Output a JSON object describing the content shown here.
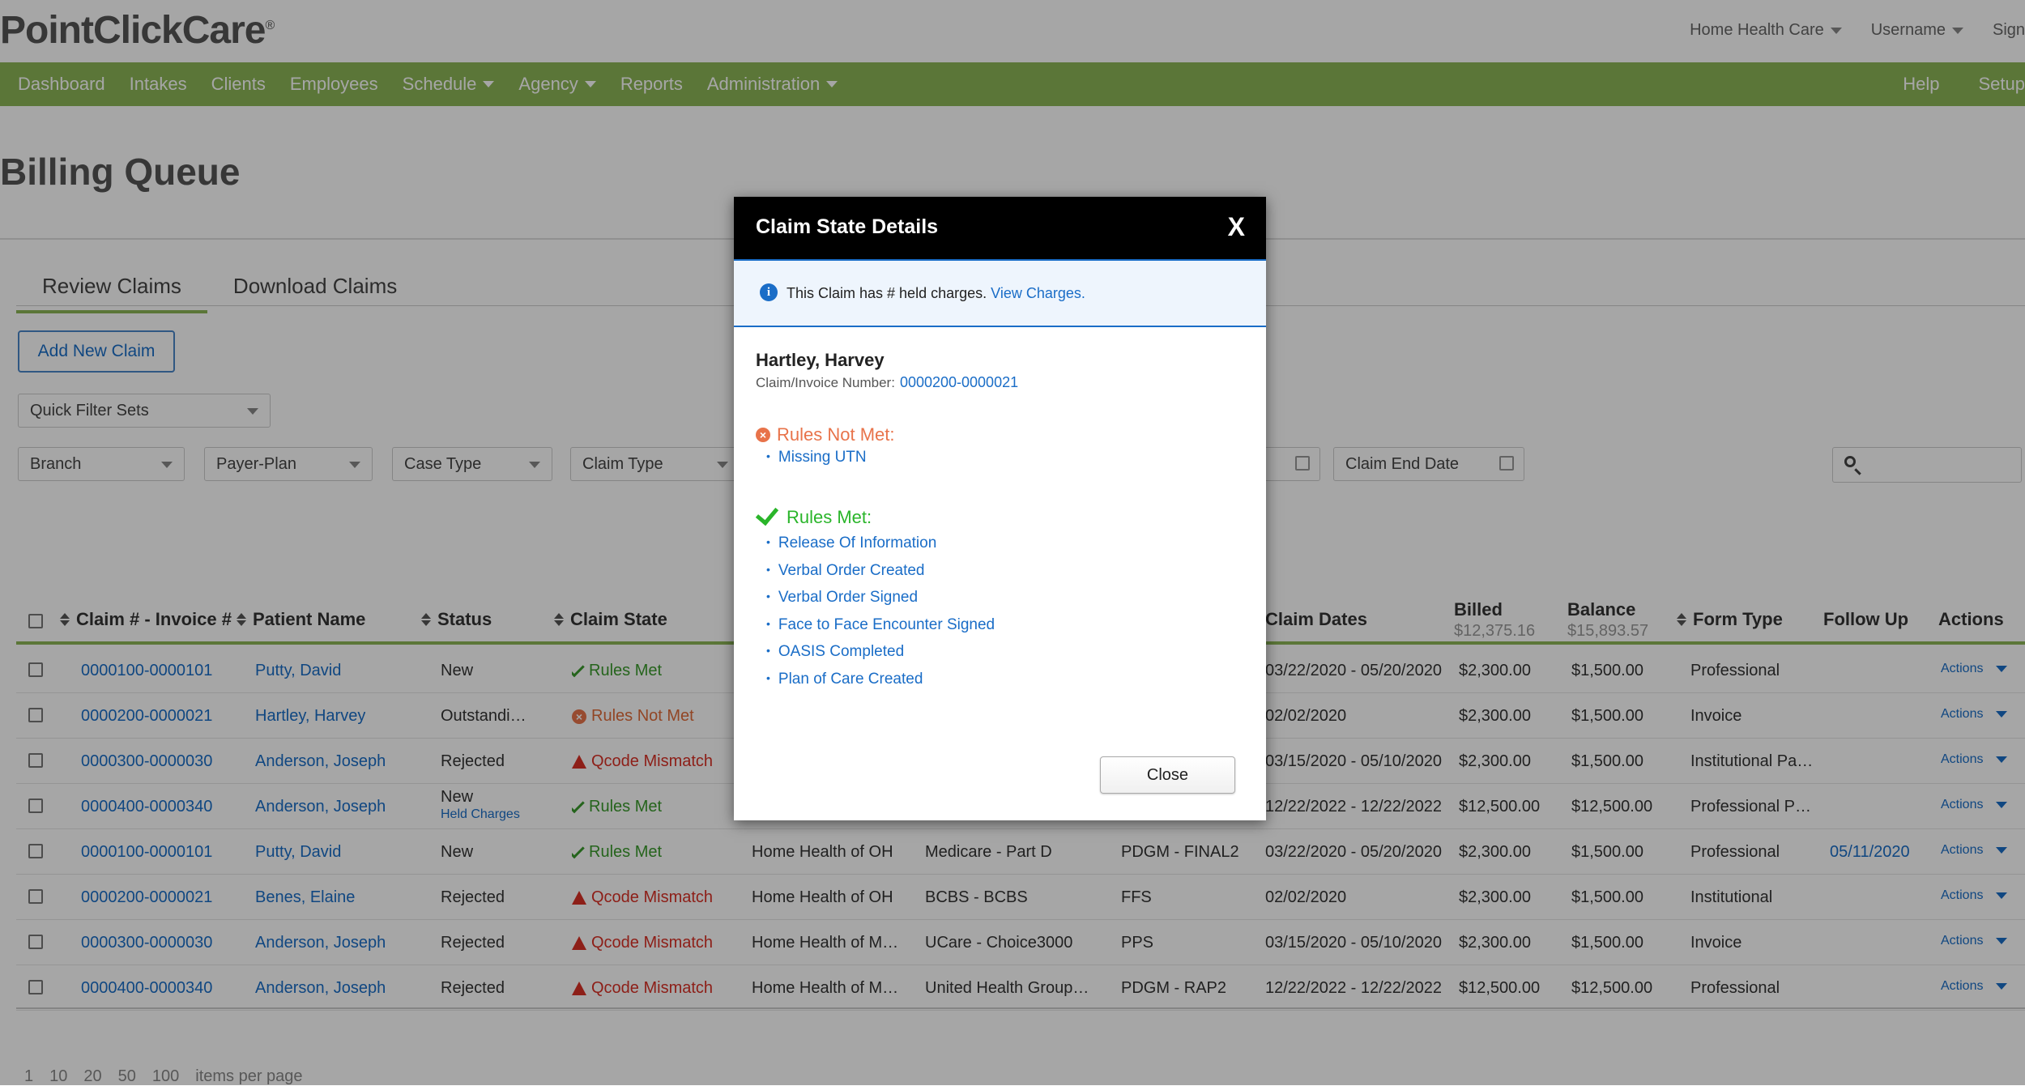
{
  "header": {
    "logo": "PointClickCare",
    "logo_mark": "®",
    "agency": "Home Health Care",
    "user": "Username",
    "signout": "Sign Out"
  },
  "nav": {
    "items": [
      "Dashboard",
      "Intakes",
      "Clients",
      "Employees",
      "Schedule",
      "Agency",
      "Reports",
      "Administration"
    ],
    "right": [
      "Help",
      "Setup"
    ]
  },
  "page": {
    "title": "Billing Queue",
    "tabs": [
      "Review Claims",
      "Download Claims"
    ],
    "add_button": "Add New Claim",
    "filters": {
      "quick": "Quick Filter Sets",
      "branch": "Branch",
      "payer": "Payer-Plan",
      "case": "Case Type",
      "claim_type": "Claim Type",
      "claim_end": "Claim End Date"
    }
  },
  "table": {
    "headers": {
      "claim": "Claim # - Invoice #",
      "patient": "Patient Name",
      "status": "Status",
      "state": "Claim State",
      "dates": "Claim Dates",
      "billed": "Billed",
      "billed_total": "$12,375.16",
      "balance": "Balance",
      "balance_total": "$15,893.57",
      "form": "Form Type",
      "follow": "Follow Up",
      "actions": "Actions"
    },
    "rows": [
      {
        "claim": "0000100-0000101",
        "patient": "Putty, David",
        "status": "New",
        "status_sub": "",
        "state": "Rules Met",
        "state_kind": "ok",
        "branch": "",
        "payer": "",
        "type": "",
        "dates": "03/22/2020 - 05/20/2020",
        "billed": "$2,300.00",
        "balance": "$1,500.00",
        "form": "Professional",
        "follow": "",
        "actions": "Actions"
      },
      {
        "claim": "0000200-0000021",
        "patient": "Hartley, Harvey",
        "status": "Outstandi…",
        "status_sub": "",
        "state": "Rules Not Met",
        "state_kind": "notmet",
        "branch": "",
        "payer": "",
        "type": "",
        "dates": "02/02/2020",
        "billed": "$2,300.00",
        "balance": "$1,500.00",
        "form": "Invoice",
        "follow": "",
        "actions": "Actions"
      },
      {
        "claim": "0000300-0000030",
        "patient": "Anderson, Joseph",
        "status": "Rejected",
        "status_sub": "",
        "state": "Qcode Mismatch",
        "state_kind": "bad",
        "branch": "",
        "payer": "",
        "type": "",
        "dates": "03/15/2020 - 05/10/2020",
        "billed": "$2,300.00",
        "balance": "$1,500.00",
        "form": "Institutional Pa…",
        "follow": "",
        "actions": "Actions"
      },
      {
        "claim": "0000400-0000340",
        "patient": "Anderson, Joseph",
        "status": "New",
        "status_sub": "Held Charges",
        "state": "Rules Met",
        "state_kind": "ok",
        "branch": "",
        "payer": "",
        "type": "",
        "dates": "12/22/2022 - 12/22/2022",
        "billed": "$12,500.00",
        "balance": "$12,500.00",
        "form": "Professional P…",
        "follow": "",
        "actions": "Actions"
      },
      {
        "claim": "0000100-0000101",
        "patient": "Putty, David",
        "status": "New",
        "status_sub": "",
        "state": "Rules Met",
        "state_kind": "ok",
        "branch": "Home Health of OH",
        "payer": "Medicare - Part D",
        "type": "PDGM - FINAL2",
        "dates": "03/22/2020 - 05/20/2020",
        "billed": "$2,300.00",
        "balance": "$1,500.00",
        "form": "Professional",
        "follow": "05/11/2020",
        "actions": "Actions"
      },
      {
        "claim": "0000200-0000021",
        "patient": "Benes, Elaine",
        "status": "Rejected",
        "status_sub": "",
        "state": "Qcode Mismatch",
        "state_kind": "bad",
        "branch": "Home Health of OH",
        "payer": "BCBS - BCBS",
        "type": "FFS",
        "dates": "02/02/2020",
        "billed": "$2,300.00",
        "balance": "$1,500.00",
        "form": "Institutional",
        "follow": "",
        "actions": "Actions"
      },
      {
        "claim": "0000300-0000030",
        "patient": "Anderson, Joseph",
        "status": "Rejected",
        "status_sub": "",
        "state": "Qcode Mismatch",
        "state_kind": "bad",
        "branch": "Home Health of M…",
        "payer": "UCare - Choice3000",
        "type": "PPS",
        "dates": "03/15/2020 - 05/10/2020",
        "billed": "$2,300.00",
        "balance": "$1,500.00",
        "form": "Invoice",
        "follow": "",
        "actions": "Actions"
      },
      {
        "claim": "0000400-0000340",
        "patient": "Anderson, Joseph",
        "status": "Rejected",
        "status_sub": "",
        "state": "Qcode Mismatch",
        "state_kind": "bad",
        "branch": "Home Health of M…",
        "payer": "United Health Group…",
        "type": "PDGM - RAP2",
        "dates": "12/22/2022 - 12/22/2022",
        "billed": "$12,500.00",
        "balance": "$12,500.00",
        "form": "Professional",
        "follow": "",
        "actions": "Actions"
      }
    ]
  },
  "pager": {
    "pages": "1",
    "of": "10",
    "sizes": [
      "20",
      "50",
      "100"
    ],
    "label": "items per page"
  },
  "modal": {
    "title": "Claim State Details",
    "close_x": "X",
    "info_text": "This Claim has # held charges.",
    "info_link": "View Charges.",
    "patient": "Hartley, Harvey",
    "claim_label": "Claim/Invoice Number:",
    "claim_number": "0000200-0000021",
    "not_met_title": "Rules Not Met:",
    "not_met": [
      "Missing UTN"
    ],
    "met_title": "Rules Met:",
    "met": [
      "Release Of Information",
      "Verbal Order Created",
      "Verbal Order Signed",
      "Face to Face Encounter Signed",
      "OASIS Completed",
      "Plan of Care Created"
    ],
    "close_button": "Close"
  },
  "colors": {
    "nav": "#8db657",
    "link": "#1a6dc7",
    "ok": "#3a9a2c",
    "bad": "#d93025",
    "notmet": "#e8734a"
  }
}
